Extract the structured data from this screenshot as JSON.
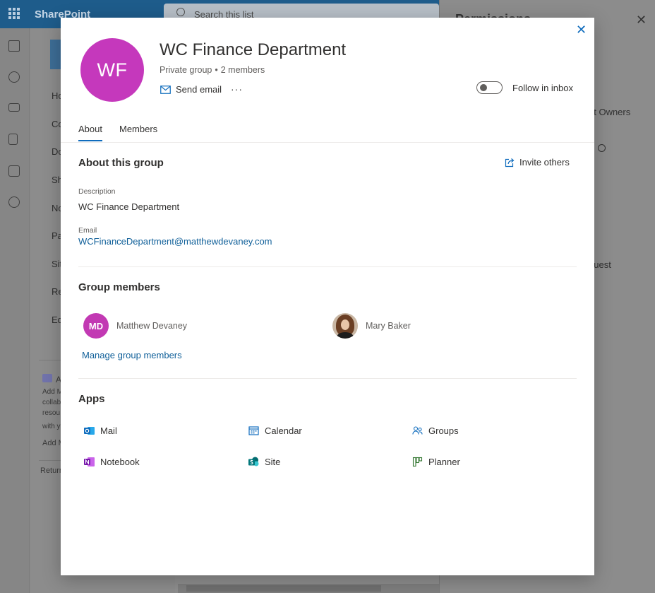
{
  "background": {
    "brand": "SharePoint",
    "search_placeholder": "Search this list",
    "nav_items": [
      "Ho",
      "Co",
      "Do",
      "Sh",
      "No",
      "Pa",
      "Sit",
      "Re",
      "Ed"
    ],
    "nav_teams_title": "A",
    "nav_teams_lines": [
      "Add M",
      "collab",
      "resou",
      "with y"
    ],
    "nav_teams_link": "Add M",
    "nav_return": "Return",
    "panel_title": "Permissions",
    "panel_texts": [
      "nt Owners",
      "guest"
    ]
  },
  "dialog": {
    "avatar_initials": "WF",
    "avatar_color": "#c538bc",
    "title": "WC Finance Department",
    "privacy": "Private group",
    "member_count": "2 members",
    "send_email": "Send email",
    "more": "···",
    "follow_label": "Follow in inbox",
    "follow_on": false,
    "close_icon": "close-icon",
    "tabs": [
      {
        "label": "About",
        "active": true
      },
      {
        "label": "Members",
        "active": false
      }
    ],
    "about": {
      "heading": "About this group",
      "invite": "Invite others",
      "description_label": "Description",
      "description": "WC Finance Department",
      "email_label": "Email",
      "email": "WCFinanceDepartment@matthewdevaney.com"
    },
    "members": {
      "heading": "Group members",
      "list": [
        {
          "initials": "MD",
          "name": "Matthew Devaney",
          "color": "#c239b3"
        },
        {
          "initials": "",
          "name": "Mary Baker",
          "photo": true
        }
      ],
      "manage": "Manage group members"
    },
    "apps": {
      "heading": "Apps",
      "items": [
        {
          "label": "Mail",
          "icon": "outlook-icon"
        },
        {
          "label": "Calendar",
          "icon": "calendar-icon"
        },
        {
          "label": "Groups",
          "icon": "groups-icon"
        },
        {
          "label": "Notebook",
          "icon": "onenote-icon"
        },
        {
          "label": "Site",
          "icon": "sharepoint-icon"
        },
        {
          "label": "Planner",
          "icon": "planner-icon"
        }
      ]
    }
  }
}
